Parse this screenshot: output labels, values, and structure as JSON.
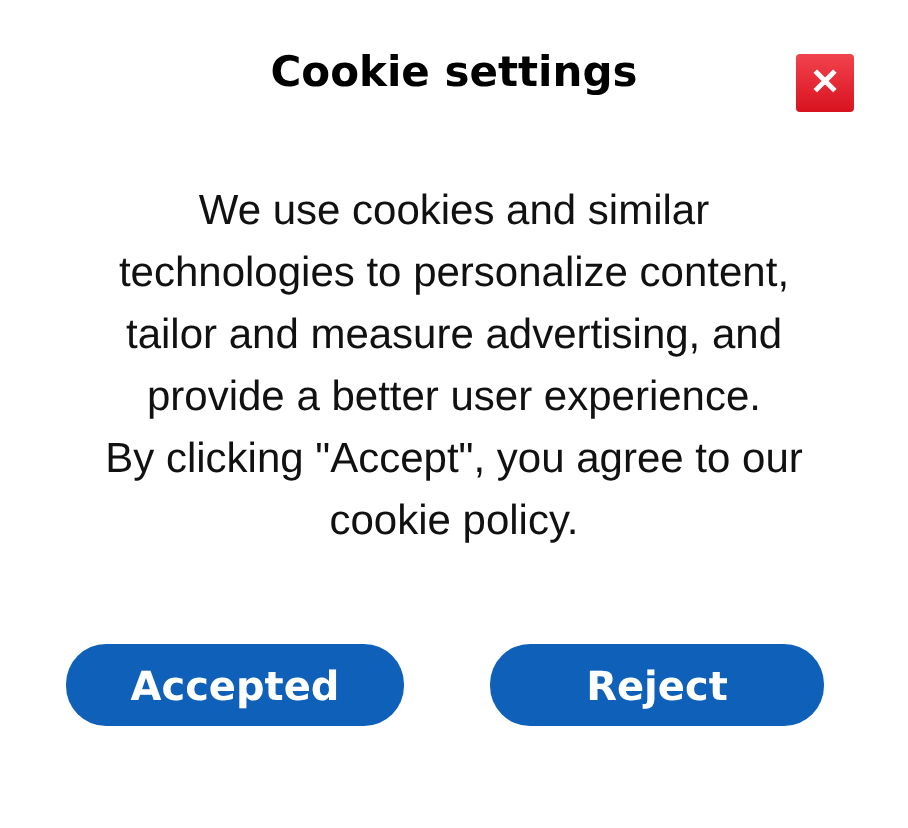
{
  "dialog": {
    "title": "Cookie settings",
    "close": "✕",
    "message": "We use cookies and similar\ntechnologies to personalize content,\ntailor and measure advertising, and\nprovide a better user experience.\nBy clicking \"Accept\", you agree to our\ncookie policy.",
    "buttons": [
      "Accepted",
      "Reject"
    ]
  }
}
